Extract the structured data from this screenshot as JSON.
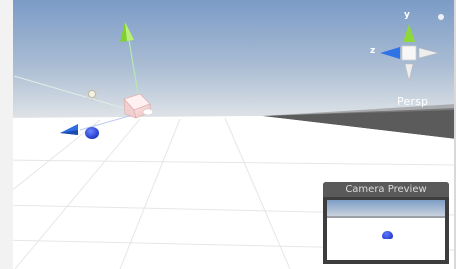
{
  "scene_view": {
    "projection_label": "Persp",
    "gizmo": {
      "y_label": "y",
      "z_label": "z",
      "menu_icon": "more-icon"
    }
  },
  "camera_preview": {
    "title": "Camera Preview"
  },
  "colors": {
    "sky_top": "#7d9bc6",
    "horizon": "#c8d1dd",
    "ground": "#ffffff",
    "y_axis": "#87d932",
    "z_axis": "#2e73e6",
    "sphere": "#1e3bd8",
    "preview_header": "#5a5a5a"
  }
}
